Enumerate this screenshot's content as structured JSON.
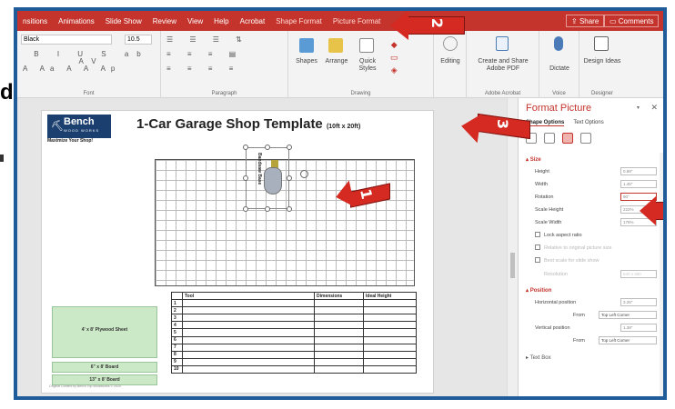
{
  "outside": {
    "letter": "d."
  },
  "tabs": [
    "nsitions",
    "Animations",
    "Slide Show",
    "Review",
    "View",
    "Help",
    "Acrobat",
    "Shape Format",
    "Picture Format"
  ],
  "share_label": "Share",
  "comments_label": "Comments",
  "ribbon": {
    "font_name": "Black",
    "font_size": "10.5",
    "groups": {
      "font": "Font",
      "paragraph": "Paragraph",
      "drawing": "Drawing",
      "acrobat": "Adobe Acrobat",
      "voice": "Voice",
      "designer": "Designer"
    },
    "shapes": "Shapes",
    "arrange": "Arrange",
    "quick_styles": "Quick Styles",
    "editing": "Editing",
    "create_share": "Create and Share Adobe PDF",
    "dictate": "Dictate",
    "design_ideas": "Design Ideas"
  },
  "slide": {
    "logo_text": "Bench",
    "logo_sub": "WOOD WORKS",
    "logo_tag": "Maximize Your Shop!",
    "title": "1-Car Garage Shop Template",
    "title_small": "(10ft x 20ft)",
    "tool_label": "Bandsaw Base",
    "table_headers": [
      "",
      "Tool",
      "Dimensions",
      "Ideal Height"
    ],
    "table_rows": [
      "1",
      "2",
      "3",
      "4",
      "5",
      "6",
      "7",
      "8",
      "9",
      "10"
    ],
    "plywood": "4' x 8' Plywood Sheet",
    "board1": "6\" x 8' Board",
    "board2": "13\" x 8' Board",
    "credit": "Original Content by Bench Top Woodworks © 2020"
  },
  "pane": {
    "title": "Format Picture",
    "tab1": "Shape Options",
    "tab2": "Text Options",
    "size_section": "Size",
    "height_label": "Height",
    "height_value": "0.89\"",
    "width_label": "Width",
    "width_value": "1.45\"",
    "rotation_label": "Rotation",
    "rotation_value": "90°",
    "scale_h_label": "Scale Height",
    "scale_h_value": "222%",
    "scale_w_label": "Scale Width",
    "scale_w_value": "176%",
    "lock_label": "Lock aspect ratio",
    "relative_label": "Relative to original picture size",
    "best_scale_label": "Best scale for slide show",
    "resolution_label": "Resolution",
    "resolution_value": "640 x 480",
    "position_section": "Position",
    "hpos_label": "Horizontal position",
    "hpos_value": "3.25\"",
    "from_label": "From",
    "from_value": "Top Left Corner",
    "vpos_label": "Vertical position",
    "vpos_value": "1.38\"",
    "from2_value": "Top Left Corner",
    "textbox_section": "Text Box"
  },
  "annotations": {
    "n1": "1",
    "n2": "2",
    "n3": "3"
  },
  "colors": {
    "accent": "#c4332c",
    "frame": "#1f5c99",
    "arrow": "#d42a22"
  }
}
